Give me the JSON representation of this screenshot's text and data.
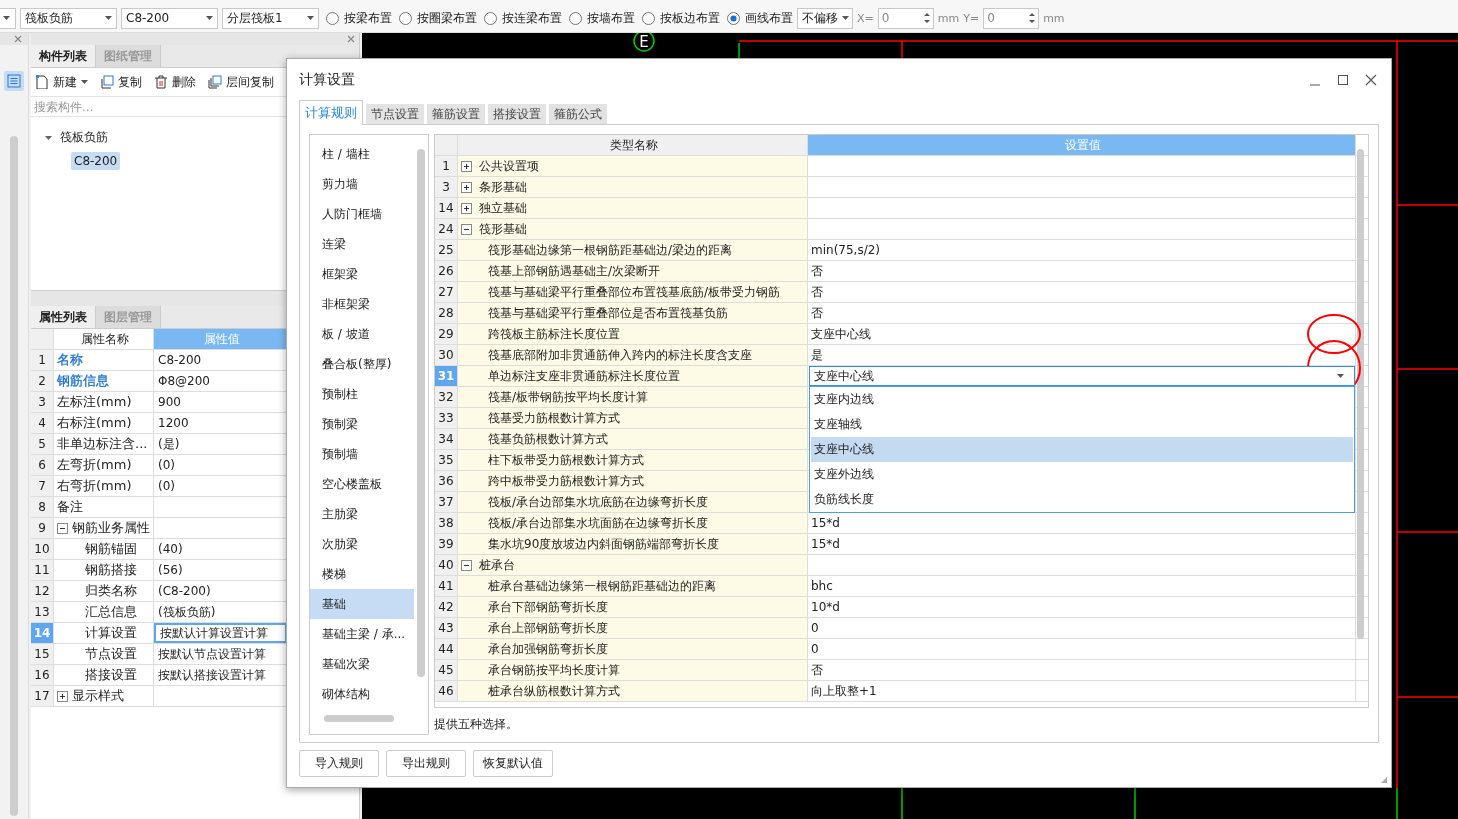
{
  "toolbar": {
    "combos": [
      {
        "value": "筏板负筋"
      },
      {
        "value": "C8-200"
      },
      {
        "value": "分层筏板1"
      }
    ],
    "radios": [
      {
        "label": "按梁布置",
        "selected": false
      },
      {
        "label": "按圈梁布置",
        "selected": false
      },
      {
        "label": "按连梁布置",
        "selected": false
      },
      {
        "label": "按墙布置",
        "selected": false
      },
      {
        "label": "按板边布置",
        "selected": false
      },
      {
        "label": "画线布置",
        "selected": true
      }
    ],
    "offset": {
      "value": "不偏移"
    },
    "x_label": "X=",
    "x_value": "0",
    "x_unit": "mm",
    "y_label": "Y=",
    "y_value": "0",
    "y_unit": "mm"
  },
  "component_panel": {
    "tabs": [
      {
        "label": "构件列表",
        "selected": true
      },
      {
        "label": "图纸管理",
        "selected": false
      }
    ],
    "actions": [
      {
        "label": "新建",
        "kind": "new"
      },
      {
        "label": "复制",
        "kind": "copy"
      },
      {
        "label": "删除",
        "kind": "delete"
      },
      {
        "label": "层间复制",
        "kind": "floor-copy"
      }
    ],
    "search": {
      "placeholder": "搜索构件..."
    },
    "tree": [
      {
        "label": "筏板负筋",
        "expanded": true,
        "selected": false,
        "children": [
          {
            "label": "C8-200",
            "selected": true
          }
        ]
      }
    ]
  },
  "property_panel": {
    "tabs": [
      {
        "label": "属性列表",
        "selected": true
      },
      {
        "label": "图层管理",
        "selected": false
      }
    ],
    "columns": [
      "属性名称",
      "属性值"
    ],
    "rows": [
      {
        "num": "1",
        "name": "名称",
        "value": "C8-200",
        "color": "#1a6fd8",
        "selected": false
      },
      {
        "num": "2",
        "name": "钢筋信息",
        "value": "Φ8@200",
        "color": "#1a6fd8",
        "selected": false
      },
      {
        "num": "3",
        "name": "左标注(mm)",
        "value": "900",
        "selected": false
      },
      {
        "num": "4",
        "name": "右标注(mm)",
        "value": "1200",
        "selected": false
      },
      {
        "num": "5",
        "name": "非单边标注含...",
        "value": "(是)",
        "selected": false
      },
      {
        "num": "6",
        "name": "左弯折(mm)",
        "value": "(0)",
        "selected": false
      },
      {
        "num": "7",
        "name": "右弯折(mm)",
        "value": "(0)",
        "selected": false
      },
      {
        "num": "8",
        "name": "备注",
        "selected": false
      },
      {
        "num": "9",
        "name": "钢筋业务属性",
        "expanded": true,
        "selected": false,
        "children": [
          {
            "num": "10",
            "name": "钢筋锚固",
            "value": "(40)",
            "selected": false
          },
          {
            "num": "11",
            "name": "钢筋搭接",
            "value": "(56)",
            "selected": false
          },
          {
            "num": "12",
            "name": "归类名称",
            "value": "(C8-200)",
            "selected": false
          },
          {
            "num": "13",
            "name": "汇总信息",
            "value": "(筏板负筋)",
            "selected": false
          },
          {
            "num": "14",
            "name": "计算设置",
            "value": "按默认计算设置计算",
            "selected": true
          },
          {
            "num": "15",
            "name": "节点设置",
            "value": "按默认节点设置计算",
            "selected": false
          },
          {
            "num": "16",
            "name": "搭接设置",
            "value": "按默认搭接设置计算",
            "selected": false
          }
        ]
      },
      {
        "num": "17",
        "name": "显示样式",
        "expanded": false,
        "selected": false
      }
    ]
  },
  "canvas": {
    "axis_label": "E"
  },
  "dialog": {
    "title": "计算设置",
    "tabs": [
      {
        "label": "计算规则",
        "selected": true
      },
      {
        "label": "节点设置",
        "selected": false
      },
      {
        "label": "箍筋设置",
        "selected": false
      },
      {
        "label": "搭接设置",
        "selected": false
      },
      {
        "label": "箍筋公式",
        "selected": false
      }
    ],
    "categories": [
      {
        "label": "柱 / 墙柱",
        "selected": false
      },
      {
        "label": "剪力墙",
        "selected": false
      },
      {
        "label": "人防门框墙",
        "selected": false
      },
      {
        "label": "连梁",
        "selected": false
      },
      {
        "label": "框架梁",
        "selected": false
      },
      {
        "label": "非框架梁",
        "selected": false
      },
      {
        "label": "板 / 坡道",
        "selected": false
      },
      {
        "label": "叠合板(整厚)",
        "selected": false
      },
      {
        "label": "预制柱",
        "selected": false
      },
      {
        "label": "预制梁",
        "selected": false
      },
      {
        "label": "预制墙",
        "selected": false
      },
      {
        "label": "空心楼盖板",
        "selected": false
      },
      {
        "label": "主肋梁",
        "selected": false
      },
      {
        "label": "次肋梁",
        "selected": false
      },
      {
        "label": "楼梯",
        "selected": false
      },
      {
        "label": "基础",
        "selected": true
      },
      {
        "label": "基础主梁 / 承...",
        "selected": false
      },
      {
        "label": "基础次梁",
        "selected": false
      },
      {
        "label": "砌体结构",
        "selected": false
      }
    ],
    "columns": [
      "类型名称",
      "设置值"
    ],
    "rows": [
      {
        "num": "1",
        "label": "公共设置项",
        "expanded": false,
        "selected": false
      },
      {
        "num": "3",
        "label": "条形基础",
        "expanded": false,
        "selected": false
      },
      {
        "num": "14",
        "label": "独立基础",
        "expanded": false,
        "selected": false
      },
      {
        "num": "24",
        "label": "筏形基础",
        "expanded": true,
        "selected": false,
        "children": [
          {
            "num": "25",
            "label": "筏形基础边缘第一根钢筋距基础边/梁边的距离",
            "value": "min(75,s/2)",
            "selected": false
          },
          {
            "num": "26",
            "label": "筏基上部钢筋遇基础主/次梁断开",
            "value": "否",
            "selected": false
          },
          {
            "num": "27",
            "label": "筏基与基础梁平行重叠部位布置筏基底筋/板带受力钢筋",
            "value": "否",
            "selected": false
          },
          {
            "num": "28",
            "label": "筏基与基础梁平行重叠部位是否布置筏基负筋",
            "value": "否",
            "selected": false
          },
          {
            "num": "29",
            "label": "跨筏板主筋标注长度位置",
            "value": "支座中心线",
            "selected": false
          },
          {
            "num": "30",
            "label": "筏基底部附加非贯通筋伸入跨内的标注长度含支座",
            "value": "是",
            "selected": false
          },
          {
            "num": "31",
            "label": "单边标注支座非贯通筋标注长度位置",
            "value": "支座中心线",
            "selected": true,
            "options": [
              {
                "label": "支座内边线",
                "selected": false
              },
              {
                "label": "支座轴线",
                "selected": false
              },
              {
                "label": "支座中心线",
                "selected": true
              },
              {
                "label": "支座外边线",
                "selected": false
              },
              {
                "label": "负筋线长度",
                "selected": false
              }
            ]
          },
          {
            "num": "32",
            "label": "筏基/板带钢筋按平均长度计算",
            "selected": false
          },
          {
            "num": "33",
            "label": "筏基受力筋根数计算方式",
            "selected": false
          },
          {
            "num": "34",
            "label": "筏基负筋根数计算方式",
            "selected": false
          },
          {
            "num": "35",
            "label": "柱下板带受力筋根数计算方式",
            "selected": false
          },
          {
            "num": "36",
            "label": "跨中板带受力筋根数计算方式",
            "selected": false
          },
          {
            "num": "37",
            "label": "筏板/承台边部集水坑底筋在边缘弯折长度",
            "selected": false
          },
          {
            "num": "38",
            "label": "筏板/承台边部集水坑面筋在边缘弯折长度",
            "value": "15*d",
            "selected": false
          },
          {
            "num": "39",
            "label": "集水坑90度放坡边内斜面钢筋端部弯折长度",
            "value": "15*d",
            "selected": false
          }
        ]
      },
      {
        "num": "40",
        "label": "桩承台",
        "expanded": true,
        "selected": false,
        "children": [
          {
            "num": "41",
            "label": "桩承台基础边缘第一根钢筋距基础边的距离",
            "value": "bhc",
            "selected": false
          },
          {
            "num": "42",
            "label": "承台下部钢筋弯折长度",
            "value": "10*d",
            "selected": false
          },
          {
            "num": "43",
            "label": "承台上部钢筋弯折长度",
            "value": "0",
            "selected": false
          },
          {
            "num": "44",
            "label": "承台加强钢筋弯折长度",
            "value": "0",
            "selected": false
          },
          {
            "num": "45",
            "label": "承台钢筋按平均长度计算",
            "value": "否",
            "selected": false
          },
          {
            "num": "46",
            "label": "桩承台纵筋根数计算方式",
            "value": "向上取整+1",
            "selected": false
          }
        ]
      }
    ],
    "description": "提供五种选择。",
    "buttons": [
      "导入规则",
      "导出规则",
      "恢复默认值"
    ]
  }
}
